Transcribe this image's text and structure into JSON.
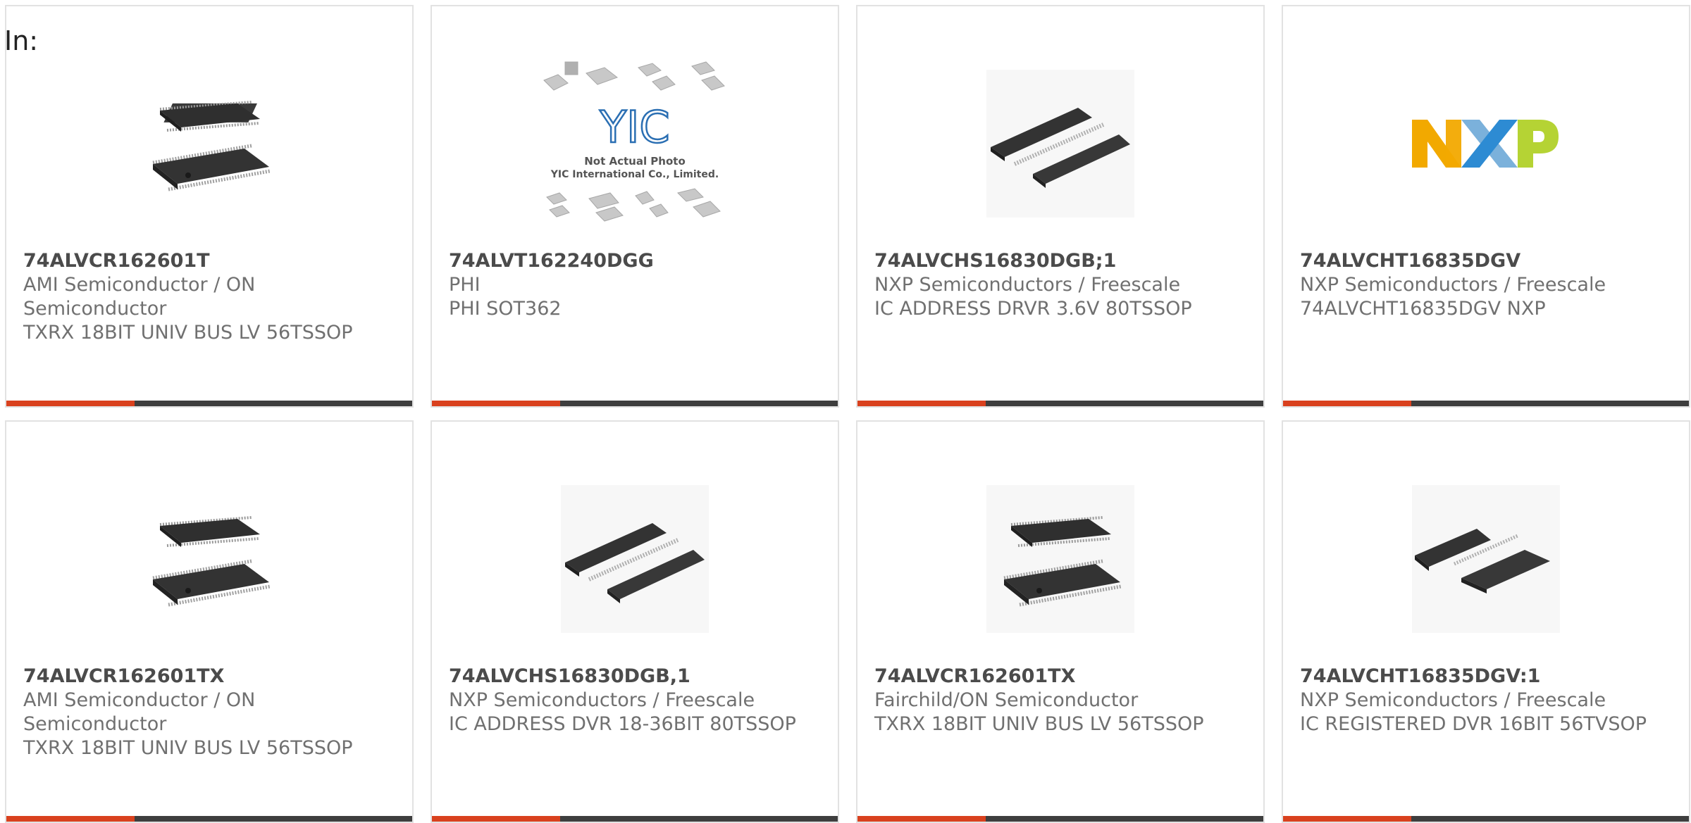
{
  "page": {
    "in_label": "In:"
  },
  "colors": {
    "accent": "#d9411e",
    "bar": "#3e3e3e",
    "part_number": "#4b4b4b",
    "text": "#707070",
    "border": "#e2e2e2"
  },
  "cards": [
    {
      "part_number": "74ALVCR162601T",
      "manufacturer": "AMI Semiconductor / ON Semiconductor",
      "description": "TXRX 18BIT UNIV BUS LV 56TSSOP",
      "image": "chip-tssop-image"
    },
    {
      "part_number": "74ALVT162240DGG",
      "manufacturer": "PHI",
      "description": "PHI SOT362",
      "image": "yic-placeholder-image",
      "image_caption": {
        "logo": "YIC",
        "line1": "Not Actual Photo",
        "line2": "YIC International Co., Limited."
      }
    },
    {
      "part_number": "74ALVCHS16830DGB;1",
      "manufacturer": "NXP Semiconductors / Freescale",
      "description": "IC ADDRESS DRVR 3.6V 80TSSOP",
      "image": "chip-tssop-pair-image"
    },
    {
      "part_number": "74ALVCHT16835DGV",
      "manufacturer": "NXP Semiconductors / Freescale",
      "description": "74ALVCHT16835DGV NXP",
      "image": "nxp-logo-image",
      "logo_text": "NXP"
    },
    {
      "part_number": "74ALVCR162601TX",
      "manufacturer": "AMI Semiconductor / ON Semiconductor",
      "description": "TXRX 18BIT UNIV BUS LV 56TSSOP",
      "image": "chip-tssop-image"
    },
    {
      "part_number": "74ALVCHS16830DGB,1",
      "manufacturer": "NXP Semiconductors / Freescale",
      "description": "IC ADDRESS DVR 18-36BIT 80TSSOP",
      "image": "chip-tssop-pair-image"
    },
    {
      "part_number": "74ALVCR162601TX",
      "manufacturer": "Fairchild/ON Semiconductor",
      "description": "TXRX 18BIT UNIV BUS LV 56TSSOP",
      "image": "chip-tssop-image"
    },
    {
      "part_number": "74ALVCHT16835DGV:1",
      "manufacturer": "NXP Semiconductors / Freescale",
      "description": "IC REGISTERED DVR 16BIT 56TVSOP",
      "image": "chip-tssop-pair-image"
    }
  ]
}
